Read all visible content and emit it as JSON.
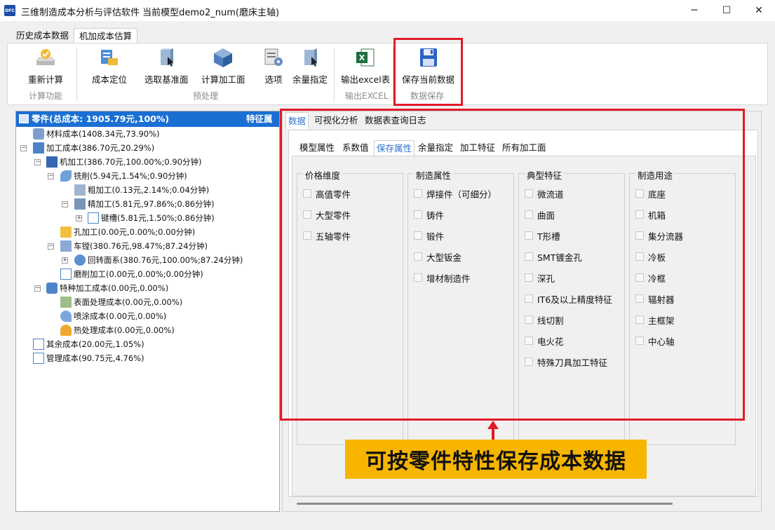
{
  "window": {
    "logo_text": "DFC",
    "title": "三维制造成本分析与评估软件 当前模型demo2_num(磨床主轴)",
    "minimize_glyph": "─",
    "maximize_glyph": "☐",
    "close_glyph": "✕"
  },
  "ribbon_tabs": [
    "历史成本数据",
    "机加成本估算"
  ],
  "ribbon": {
    "buttons": [
      "重新计算",
      "成本定位",
      "选取基准面",
      "计算加工面",
      "选项",
      "余量指定",
      "输出excel表",
      "保存当前数据"
    ],
    "groups": [
      "计算功能",
      "预处理",
      "输出EXCEL",
      "数据保存"
    ]
  },
  "tree": {
    "header": "零件(总成本: 1905.79元,100%)",
    "header_right": "特征属",
    "nodes": [
      "材料成本(1408.34元,73.90%)",
      "加工成本(386.70元,20.29%)",
      "机加工(386.70元,100.00%;0.90分钟)",
      "铣削(5.94元,1.54%;0.90分钟)",
      "粗加工(0.13元,2.14%;0.04分钟)",
      "精加工(5.81元,97.86%;0.86分钟)",
      "键槽(5.81元,1.50%;0.86分钟)",
      "孔加工(0.00元,0.00%;0.00分钟)",
      "车镗(380.76元,98.47%;87.24分钟)",
      "回转面系(380.76元,100.00%;87.24分钟)",
      "磨削加工(0.00元,0.00%;0.00分钟)",
      "特种加工成本(0.00元,0.00%)",
      "表面处理成本(0.00元,0.00%)",
      "喷涂成本(0.00元,0.00%)",
      "热处理成本(0.00元,0.00%)",
      "其余成本(20.00元,1.05%)",
      "管理成本(90.75元,4.76%)"
    ]
  },
  "right_tabs": [
    "数据",
    "可视化分析",
    "数据表查询日志"
  ],
  "sub_tabs": [
    "模型属性",
    "系数值",
    "保存属性",
    "余量指定",
    "加工特征",
    "所有加工面"
  ],
  "groups": [
    {
      "title": "价格维度",
      "items": [
        "高值零件",
        "大型零件",
        "五轴零件"
      ]
    },
    {
      "title": "制造属性",
      "items": [
        "焊接件（可细分）",
        "铸件",
        "锻件",
        "大型钣金",
        "增材制造件"
      ]
    },
    {
      "title": "典型特征",
      "items": [
        "微流道",
        "曲面",
        "T形槽",
        "SMT镀金孔",
        "深孔",
        "IT6及以上精度特征",
        "线切割",
        "电火花",
        "特殊刀具加工特征"
      ]
    },
    {
      "title": "制造用途",
      "items": [
        "底座",
        "机箱",
        "集分流器",
        "冷板",
        "冷框",
        "辐射器",
        "主框架",
        "中心轴"
      ]
    }
  ],
  "annotation": {
    "callout": "可按零件特性保存成本数据"
  },
  "colors": {
    "tree_header": "#1a6fd3",
    "active_tab_text": "#2f73d2",
    "highlight_border": "#e11b27",
    "callout_bg": "#f7b500"
  }
}
